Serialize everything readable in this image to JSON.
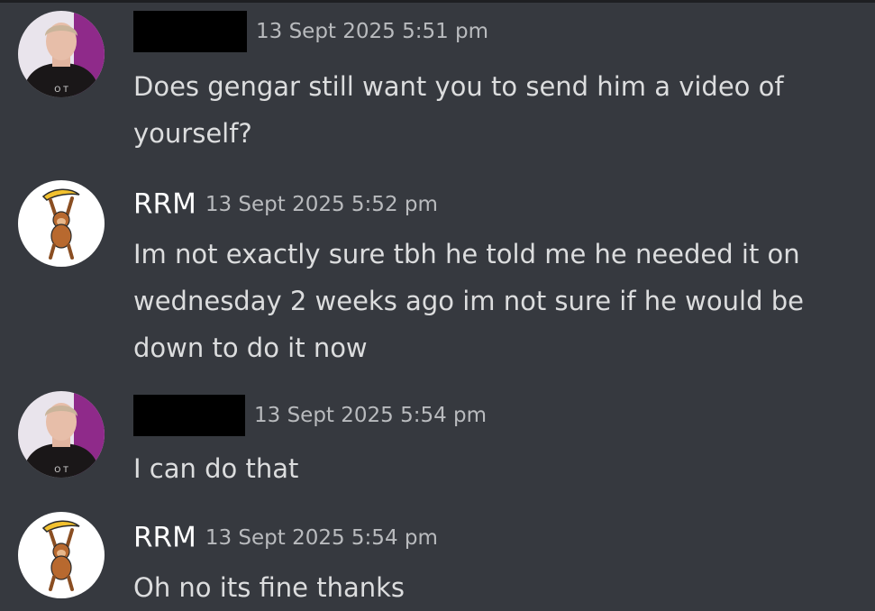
{
  "messages": [
    {
      "author": "",
      "author_redacted": true,
      "avatar": "user-photo-avatar",
      "timestamp": "13 Sept 2025 5:51 pm",
      "text": "Does gengar still want you to send him a video of yourself?"
    },
    {
      "author": "RRM",
      "author_redacted": false,
      "avatar": "monkey-banana-avatar",
      "timestamp": "13 Sept 2025 5:52 pm",
      "text": "Im not exactly sure tbh he told me he needed it on wednesday 2 weeks ago im not sure if he would be down to do it now"
    },
    {
      "author": "",
      "author_redacted": true,
      "avatar": "user-photo-avatar",
      "timestamp": "13 Sept 2025 5:54 pm",
      "text": "I can do that"
    },
    {
      "author": "RRM",
      "author_redacted": false,
      "avatar": "monkey-banana-avatar",
      "timestamp": "13 Sept 2025 5:54 pm",
      "text": "Oh no its fine thanks"
    }
  ],
  "colors": {
    "background": "#36393f",
    "username": "#ffffff",
    "timestamp": "#b9bbbe",
    "message_text": "#dcddde",
    "redaction": "#000000"
  }
}
